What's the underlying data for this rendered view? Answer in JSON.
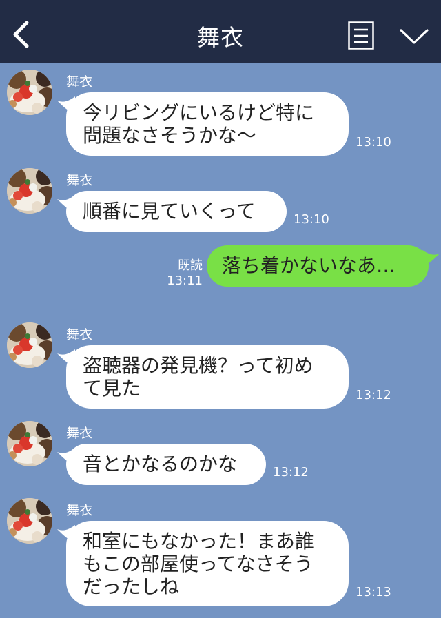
{
  "header": {
    "title": "舞衣"
  },
  "messages": [
    {
      "sender": "舞衣",
      "text": "今リビングにいるけど特に\n問題なさそうかな〜",
      "time": "13:10"
    },
    {
      "sender": "舞衣",
      "text": "順番に見ていくって",
      "time": "13:10"
    },
    {
      "text": "落ち着かないなあ…",
      "read": "既読",
      "time": "13:11"
    },
    {
      "sender": "舞衣",
      "text": "盗聴器の発見機？って初め\nて見た",
      "time": "13:12"
    },
    {
      "sender": "舞衣",
      "text": "音とかなるのかな",
      "time": "13:12"
    },
    {
      "sender": "舞衣",
      "text": "和室にもなかった！まあ誰\nもこの部屋使ってなさそう\nだったしね",
      "time": "13:13"
    }
  ]
}
